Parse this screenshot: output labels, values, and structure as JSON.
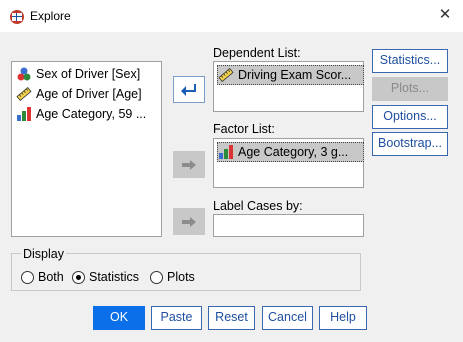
{
  "window": {
    "title": "Explore",
    "close_glyph": "✕"
  },
  "variables": [
    {
      "label": "Sex of Driver [Sex]",
      "icon": "nominal-icon"
    },
    {
      "label": "Age of Driver [Age]",
      "icon": "scale-ruler-icon"
    },
    {
      "label": "Age Category, 59 ...",
      "icon": "ordinal-bar-icon"
    }
  ],
  "dependent": {
    "label": "Dependent List:",
    "item": "Driving Exam Scor..."
  },
  "factor": {
    "label": "Factor List:",
    "item": "Age Category, 3 g..."
  },
  "label_cases": {
    "label": "Label Cases by:",
    "value": ""
  },
  "side_buttons": {
    "statistics": "Statistics...",
    "plots": "Plots...",
    "options": "Options...",
    "bootstrap": "Bootstrap..."
  },
  "display": {
    "label": "Display",
    "options": [
      "Both",
      "Statistics",
      "Plots"
    ],
    "selected": "Statistics"
  },
  "bottom_buttons": {
    "ok": "OK",
    "paste": "Paste",
    "reset": "Reset",
    "cancel": "Cancel",
    "help": "Help"
  },
  "colors": {
    "accent": "#0a6fe8",
    "link_text": "#1f4fa0",
    "arrow_blue": "#1a5fb4"
  }
}
